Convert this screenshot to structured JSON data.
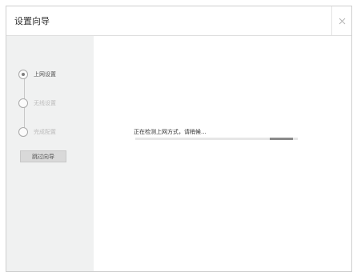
{
  "window": {
    "title": "设置向导",
    "close_icon": "close-icon"
  },
  "sidebar": {
    "steps": [
      {
        "label": "上网设置",
        "state": "active"
      },
      {
        "label": "无线设置",
        "state": "inactive"
      },
      {
        "label": "完成配置",
        "state": "inactive"
      }
    ],
    "skip_label": "跳过向导"
  },
  "main": {
    "status_text": "正在检测上网方式，请稍候...",
    "progress": {
      "indicator_start": 0.83,
      "indicator_end": 0.97
    }
  },
  "colors": {
    "sidebar_bg": "#f0f1f1",
    "progress_track": "#e6e6e6",
    "progress_indicator": "#8a8a8a"
  }
}
